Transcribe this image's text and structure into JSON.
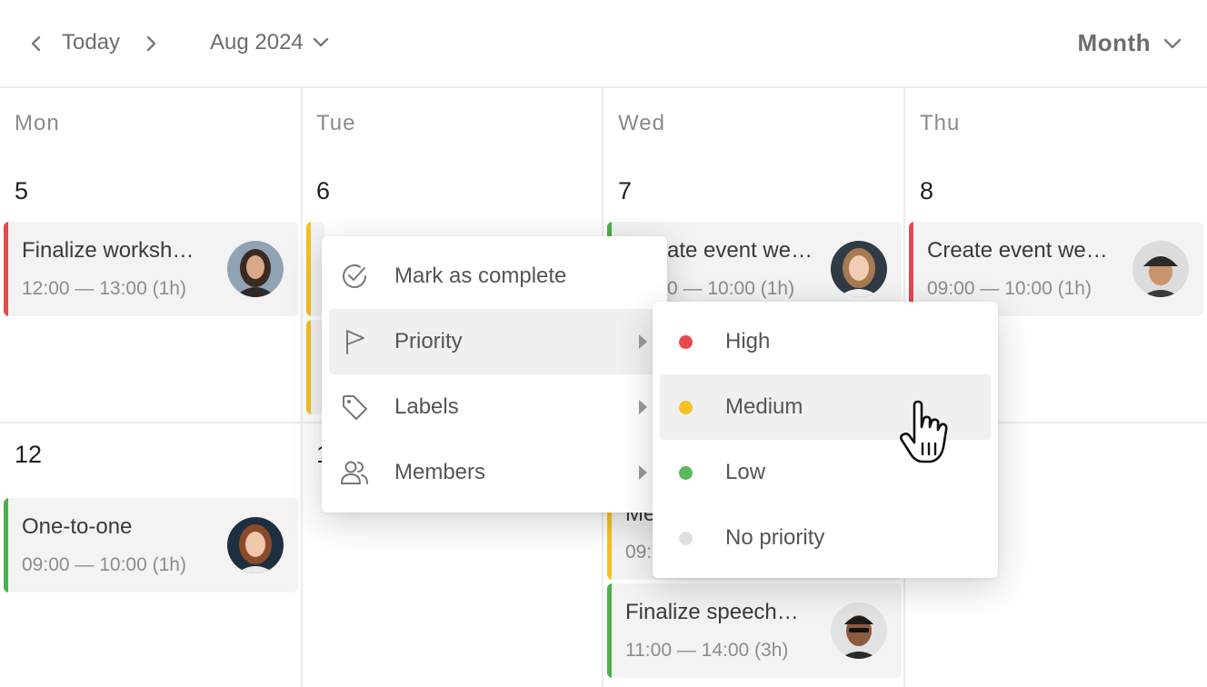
{
  "toolbar": {
    "prev_icon": "chevron-left-icon",
    "today_label": "Today",
    "next_icon": "chevron-right-icon",
    "month_label": "Aug 2024",
    "view_label": "Month"
  },
  "weekdays": [
    "Mon",
    "Tue",
    "Wed",
    "Thu"
  ],
  "week1_dates": [
    "5",
    "6",
    "7",
    "8"
  ],
  "week2_dates": [
    "12",
    "1"
  ],
  "events": {
    "mon_workshop": {
      "title": "Finalize worksh…",
      "time": "12:00 — 13:00 (1h)",
      "priority_color": "#e5484d"
    },
    "wed_create": {
      "title": "ate event we…",
      "time": "0 — 10:00 (1h)",
      "priority_color": "#4caf50"
    },
    "thu_create": {
      "title": "Create event we…",
      "time": "09:00 — 10:00 (1h)",
      "priority_color": "#e5484d"
    },
    "mon_one_to_one": {
      "title": "One-to-one",
      "time": "09:00 — 10:00 (1h)",
      "priority_color": "#4caf50"
    },
    "wed_meeting": {
      "title": "Me",
      "time": "09:",
      "priority_color": "#f5c125"
    },
    "wed_speech": {
      "title": "Finalize speech…",
      "time": "11:00 — 14:00 (3h)",
      "priority_color": "#4caf50"
    },
    "tue_partial_color": "#f5c125"
  },
  "context_menu": {
    "items": [
      {
        "label": "Mark as complete",
        "icon": "check-circle-icon"
      },
      {
        "label": "Priority",
        "icon": "flag-icon"
      },
      {
        "label": "Labels",
        "icon": "tag-icon"
      },
      {
        "label": "Members",
        "icon": "users-icon"
      }
    ]
  },
  "priority_menu": {
    "items": [
      {
        "label": "High",
        "color": "#e5484d"
      },
      {
        "label": "Medium",
        "color": "#f5c125"
      },
      {
        "label": "Low",
        "color": "#5cb85c"
      },
      {
        "label": "No priority",
        "color": "#e0e0e0"
      }
    ]
  },
  "colors": {
    "accent_red": "#e5484d",
    "accent_yellow": "#f5c125",
    "accent_green": "#4caf50",
    "event_bg": "#f3f3f3",
    "hover_bg": "#f0f0f0"
  }
}
